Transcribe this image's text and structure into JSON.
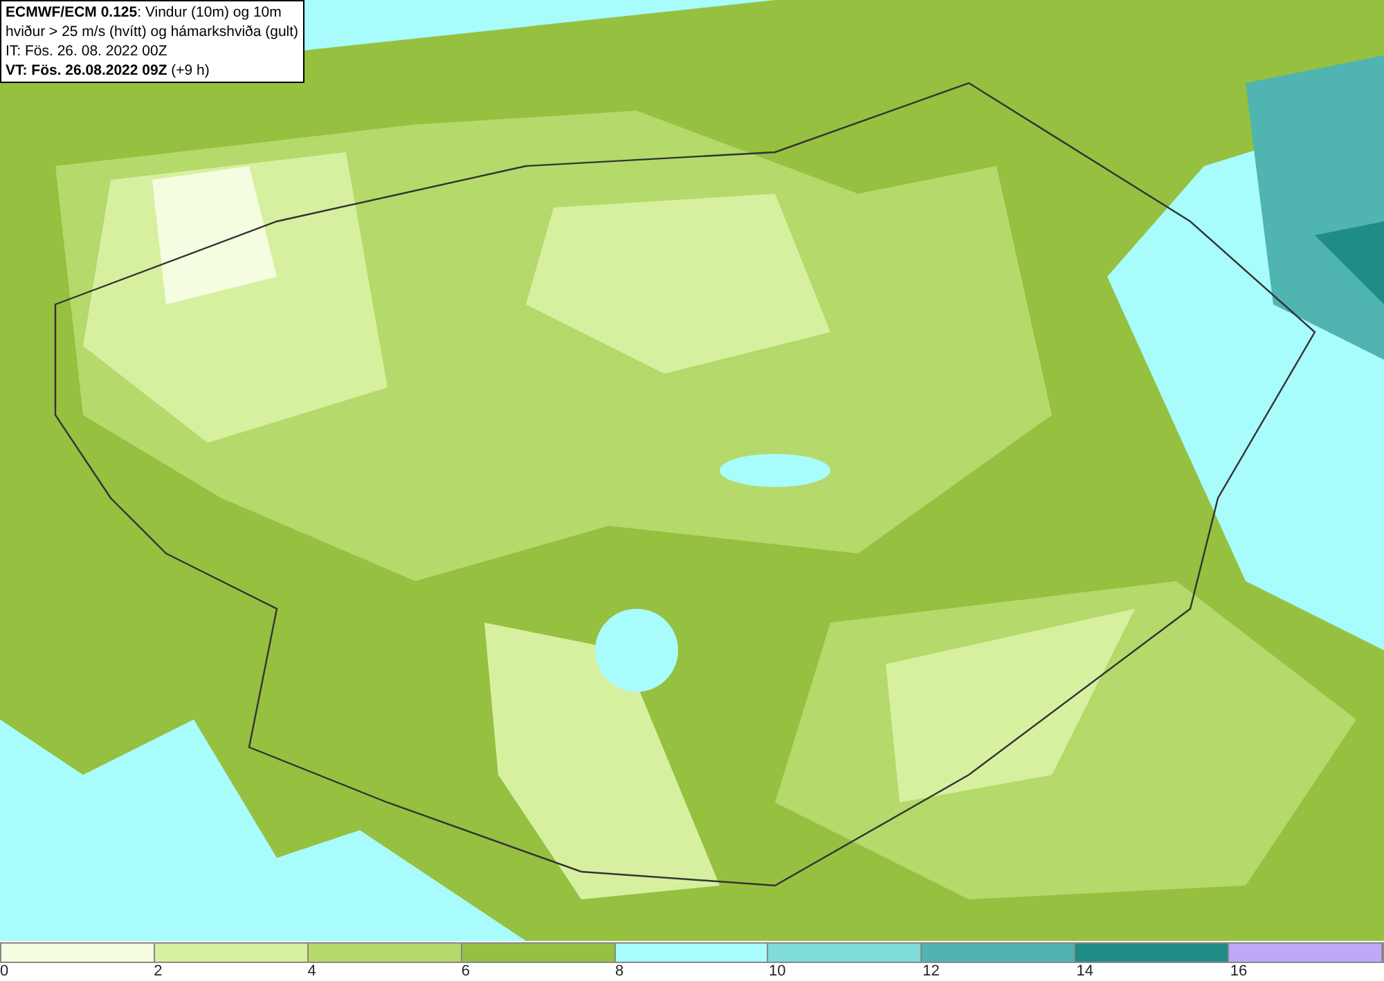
{
  "info_box": {
    "lines": [
      "**ECMWF/ECM 0.125**: Vindur (10m) og 10m",
      "hviður > 25 m/s (hvítt) og hámarkshviða (gult)",
      "IT: Fös. 26. 08. 2022 00Z",
      "**VT: Fös. 26.08.2022 09Z** (+9 h)"
    ]
  },
  "legend": {
    "bins": [
      {
        "color": "#f5fde0",
        "label": "0"
      },
      {
        "color": "#d6f0a0",
        "label": "2"
      },
      {
        "color": "#b5d96a",
        "label": "4"
      },
      {
        "color": "#96c040",
        "label": "6"
      },
      {
        "color": "#a8fcfc",
        "label": "8"
      },
      {
        "color": "#80dcd8",
        "label": "10"
      },
      {
        "color": "#50b4b0",
        "label": "12"
      },
      {
        "color": "#208c88",
        "label": "14"
      },
      {
        "color": "#c0a8f8",
        "label": "16"
      }
    ]
  }
}
